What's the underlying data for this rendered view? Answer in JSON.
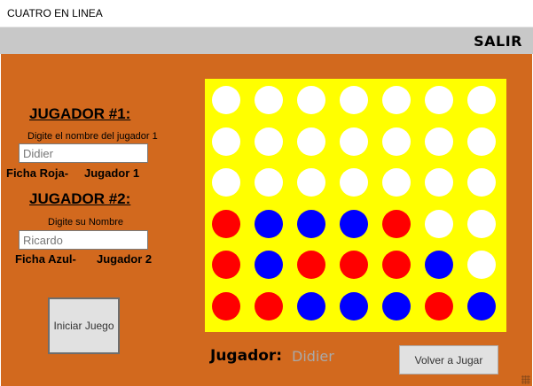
{
  "window": {
    "title": "CUATRO EN LINEA"
  },
  "menu": {
    "exit_label": "SALIR"
  },
  "player1": {
    "title": "JUGADOR #1:",
    "hint": "Digite el nombre del jugador 1",
    "name": "Didier",
    "chip_label": "Ficha Roja-",
    "player_label": "Jugador 1"
  },
  "player2": {
    "title": "JUGADOR #2:",
    "hint": "Digite su Nombre",
    "name": "Ricardo",
    "chip_label": "Ficha Azul-",
    "player_label": "Jugador 2"
  },
  "buttons": {
    "start": "Iniciar Juego",
    "replay": "Volver a Jugar"
  },
  "turn": {
    "label": "Jugador:",
    "current": "Didier"
  },
  "colors": {
    "board": "#ffff00",
    "empty": "#ffffff",
    "red": "#ff0000",
    "blue": "#0000ff",
    "background": "#d2691e"
  },
  "board": {
    "rows": 6,
    "cols": 7,
    "cells": [
      [
        "empty",
        "empty",
        "empty",
        "empty",
        "empty",
        "empty",
        "empty"
      ],
      [
        "empty",
        "empty",
        "empty",
        "empty",
        "empty",
        "empty",
        "empty"
      ],
      [
        "empty",
        "empty",
        "empty",
        "empty",
        "empty",
        "empty",
        "empty"
      ],
      [
        "red",
        "blue",
        "blue",
        "blue",
        "red",
        "empty",
        "empty"
      ],
      [
        "red",
        "blue",
        "red",
        "red",
        "red",
        "blue",
        "empty"
      ],
      [
        "red",
        "red",
        "blue",
        "blue",
        "blue",
        "red",
        "blue"
      ]
    ]
  }
}
